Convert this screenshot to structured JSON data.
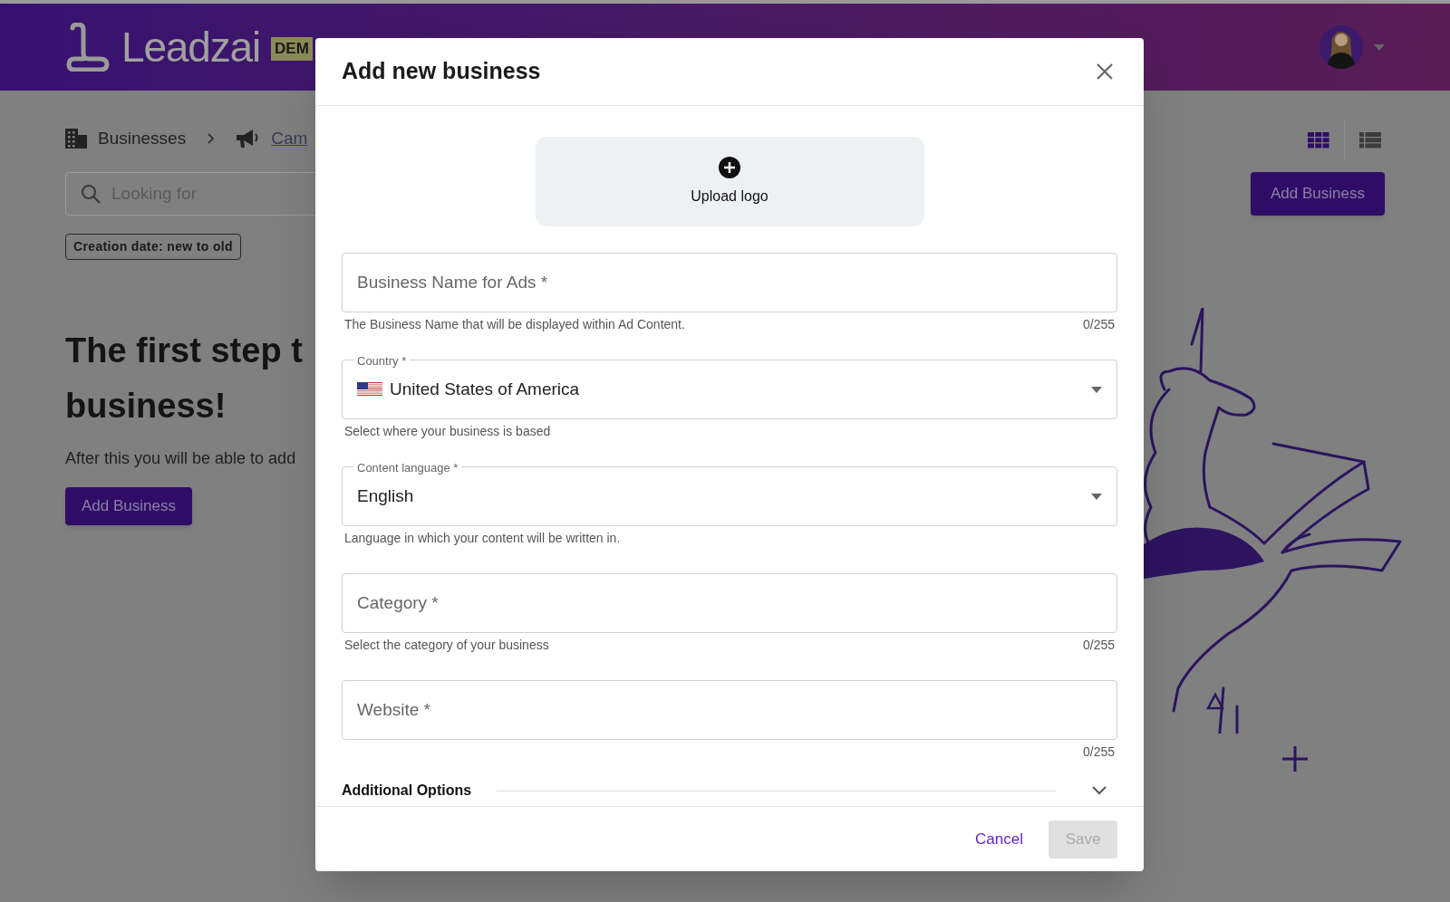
{
  "header": {
    "logo_text": "Leadzai",
    "badge": "DEM"
  },
  "breadcrumb": [
    {
      "label": "Businesses",
      "kind": "current"
    },
    {
      "label": "Cam",
      "kind": "link"
    }
  ],
  "search": {
    "placeholder": "Looking for"
  },
  "sort_chip": "Creation date: new to old",
  "empty_state": {
    "heading_lines": [
      "The first step t",
      "business!"
    ],
    "description": "After this you will be able to add",
    "button": "Add Business"
  },
  "view_toggle": [
    {
      "kind": "grid",
      "selected": true
    },
    {
      "kind": "list",
      "selected": false
    }
  ],
  "add_button": "Add Business",
  "modal": {
    "title": "Add new business",
    "upload_label": "Upload logo",
    "fields": [
      {
        "kind": "text",
        "label": "Business Name for Ads *",
        "helper": "The Business Name that will be displayed within Ad Content.",
        "counter": "0/255"
      },
      {
        "kind": "country",
        "label": "Country *",
        "value": "United States of America",
        "helper": "Select where your business is based"
      },
      {
        "kind": "select",
        "label": "Content language *",
        "value": "English",
        "helper": "Language in which your content will be written in."
      },
      {
        "kind": "text",
        "label": "Category *",
        "helper": "Select the category of your business",
        "counter": "0/255"
      },
      {
        "kind": "text",
        "label": "Website *",
        "counter": "0/255"
      }
    ],
    "additional_options": {
      "label": "Additional Options",
      "expanded": false
    },
    "cancel": "Cancel",
    "save": {
      "label": "Save",
      "disabled": true
    }
  }
}
